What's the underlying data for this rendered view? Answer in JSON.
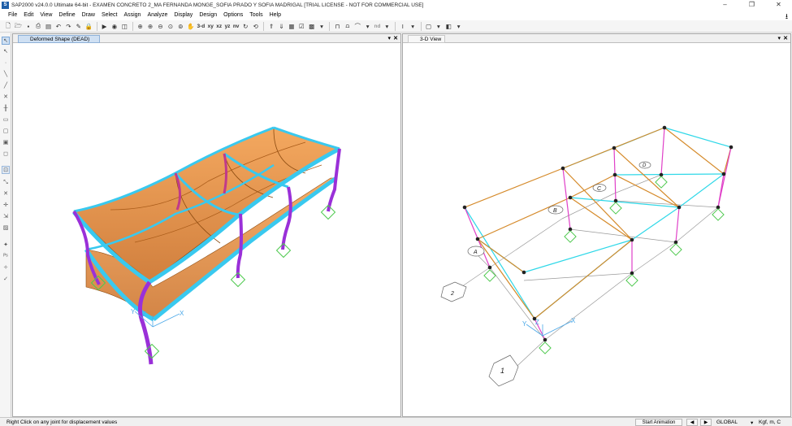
{
  "window": {
    "title": "SAP2000 v24.0.0 Ultimate 64-bit - EXAMEN CONCRETO 2_MA FERNANDA MONGE_SOFIA PRADO Y SOFIA MADRIGAL  [TRIAL LICENSE - NOT FOR COMMERCIAL USE]",
    "app_icon": "S",
    "controls": [
      "–",
      "❐",
      "✕"
    ]
  },
  "menu": [
    "File",
    "Edit",
    "View",
    "Define",
    "Draw",
    "Select",
    "Assign",
    "Analyze",
    "Display",
    "Design",
    "Options",
    "Tools",
    "Help"
  ],
  "toolbar": {
    "view_labels": [
      "3-d",
      "xy",
      "xz",
      "yz",
      "nv"
    ],
    "nd_label": "nd"
  },
  "panes": {
    "left": {
      "title": "Deformed Shape (DEAD)"
    },
    "right": {
      "title": "3-D View"
    }
  },
  "grid_labels": {
    "left_axes": [
      "Y",
      "Z",
      "X"
    ],
    "right_axes": [
      "Y",
      "Z",
      "X"
    ],
    "bubbles": [
      "A",
      "B",
      "C",
      "D",
      "2",
      "1"
    ]
  },
  "status": {
    "message": "Right Click on any joint for displacement values",
    "animation_button": "Start Animation",
    "coord_system": "GLOBAL",
    "units": "Kgf, m, C"
  },
  "colors": {
    "slab": "#e8832a",
    "beam": "#3ad0f0",
    "column": "#9a30d8",
    "grid_orange": "#d58a2a",
    "grid_cyan": "#2fd8e8",
    "grid_magenta": "#e040c8",
    "support": "#4fc94f"
  }
}
